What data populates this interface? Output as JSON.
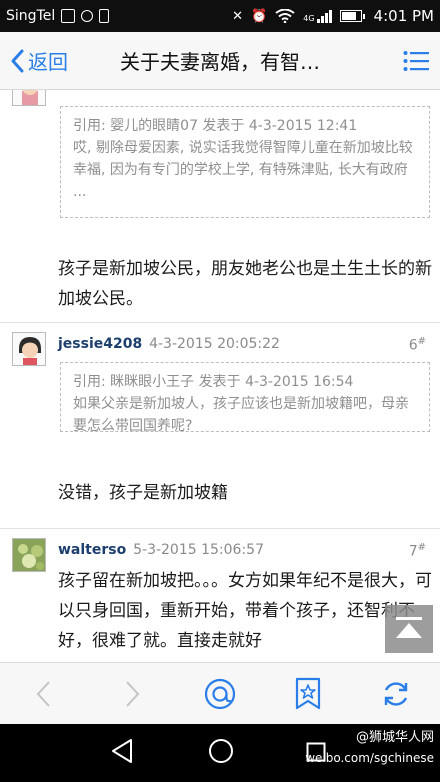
{
  "status_bar": {
    "carrier": "SingTel",
    "network": "4G",
    "time": "4:01 PM",
    "battery_level": 0.8
  },
  "navbar": {
    "back_label": "返回",
    "title": "关于夫妻离婚，有智…",
    "accent_color": "#2a7ee8"
  },
  "posts": [
    {
      "quote_header": "引用: 婴儿的眼睛07 发表于 4-3-2015 12:41",
      "quote_text": "哎, 剔除母爱因素, 说实话我觉得智障儿童在新加坡比较幸福, 因为有专门的学校上学, 有特殊津贴, 长大有政府 ...",
      "body": "孩子是新加坡公民，朋友她老公也是土生土长的新加坡公民。"
    },
    {
      "author": "jessie4208",
      "date": "4-3-2015 20:05:22",
      "floor": "6",
      "floor_mark": "#",
      "quote_header": "引用: 眯眯眼小王子 发表于 4-3-2015 16:54",
      "quote_text": "如果父亲是新加坡人，孩子应该也是新加坡籍吧，母亲要怎么带回国养呢?",
      "body": "没错，孩子是新加坡籍"
    },
    {
      "author": "walterso",
      "date": "5-3-2015 15:06:57",
      "floor": "7",
      "floor_mark": "#",
      "body": "孩子留在新加坡把。。。女方如果年纪不是很大，可以只身回国，重新开始，带着个孩子，还智利不好，很难了就。直接走就好"
    }
  ],
  "toolbar": {
    "icons": [
      "back-arrow-icon",
      "forward-arrow-icon",
      "reply-icon",
      "bookmark-star-icon",
      "refresh-icon"
    ]
  },
  "watermark": {
    "brand": "@狮城华人网",
    "url": "weibo.com/sgchinese"
  }
}
